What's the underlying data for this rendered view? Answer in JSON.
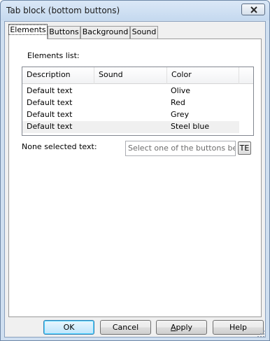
{
  "window": {
    "title": "Tab block (bottom buttons)"
  },
  "tabs": [
    {
      "label": "Elements",
      "active": true
    },
    {
      "label": "Buttons",
      "active": false
    },
    {
      "label": "Background",
      "active": false
    },
    {
      "label": "Sound",
      "active": false
    }
  ],
  "elements": {
    "list_label": "Elements list:",
    "toolbar": {
      "add_icon": "plus-icon",
      "remove_icon": "minus-icon",
      "up_icon": "arrow-up-icon",
      "down_icon": "arrow-down-icon",
      "properties_icon": "properties-icon"
    },
    "columns": [
      "Description",
      "Sound",
      "Color"
    ],
    "rows": [
      {
        "description": "Default text",
        "sound": "",
        "color": "Olive"
      },
      {
        "description": "Default text",
        "sound": "",
        "color": "Red"
      },
      {
        "description": "Default text",
        "sound": "",
        "color": "Grey"
      },
      {
        "description": "Default text",
        "sound": "",
        "color": "Steel blue"
      }
    ],
    "none_selected_label": "None selected text:",
    "none_selected_placeholder": "Select one of the buttons below",
    "te_button": "TE"
  },
  "buttons": {
    "ok": "OK",
    "cancel": "Cancel",
    "apply_underline": "A",
    "apply_rest": "pply",
    "help": "Help"
  },
  "colors": {
    "accent": "#3c7fb1",
    "toolbar_icon": "#2a6bd1"
  }
}
